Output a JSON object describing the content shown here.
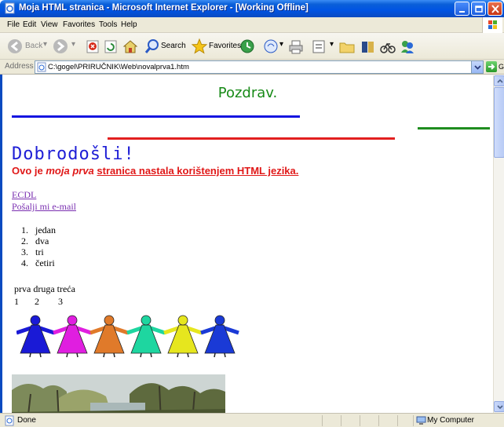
{
  "window": {
    "title": "Moja HTML stranica - Microsoft Internet Explorer - [Working Offline]"
  },
  "menu": [
    "File",
    "Edit",
    "View",
    "Favorites",
    "Tools",
    "Help"
  ],
  "toolbar": {
    "back_label": "Back",
    "search_label": "Search",
    "favorites_label": "Favorites"
  },
  "address": {
    "label": "Address",
    "value": "C:\\gogel\\PRIRUČNIK\\Web\\novalprva1.htm",
    "go_label": "Go"
  },
  "page": {
    "greeting": "Pozdrav.",
    "welcome": "Dobrodošli!",
    "intro": {
      "bold": "Ovo je ",
      "italic": "moja prva",
      "underlined": "stranica nastala korištenjem HTML jezika."
    },
    "links": {
      "ecdl": "ECDL",
      "mail": "Pošalji mi e-mail"
    },
    "ordered_list": [
      {
        "num": "1.",
        "text": "jedan"
      },
      {
        "num": "2.",
        "text": "dva"
      },
      {
        "num": "3.",
        "text": "tri"
      },
      {
        "num": "4.",
        "text": "četiri"
      }
    ],
    "table": {
      "header": "prva druga treća",
      "row": [
        "1",
        "2",
        "3"
      ]
    },
    "dancer_colors": [
      "#1a1ad6",
      "#e01ee0",
      "#e07a2a",
      "#1ed6a0",
      "#e6e61e",
      "#1a3ad6"
    ]
  },
  "status": {
    "text": "Done",
    "zone": "My Computer"
  }
}
